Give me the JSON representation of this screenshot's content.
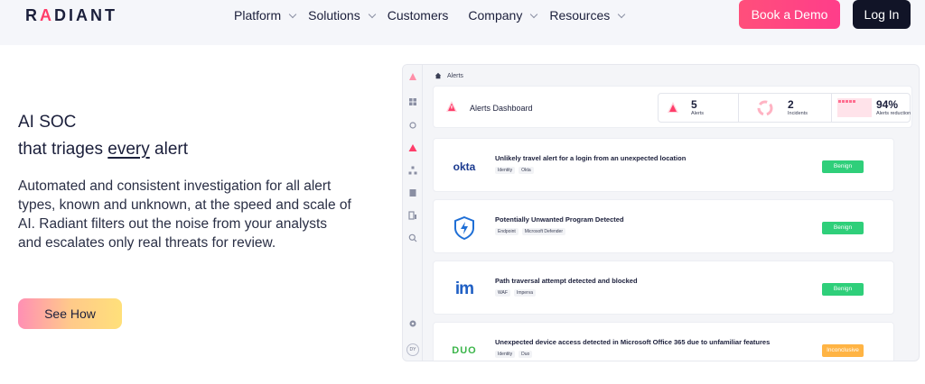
{
  "brand": {
    "logo_text_pre": "R",
    "logo_text_a": "A",
    "logo_text_post": "DIANT"
  },
  "nav": {
    "items": [
      {
        "label": "Platform",
        "has_dropdown": true
      },
      {
        "label": "Solutions",
        "has_dropdown": true
      },
      {
        "label": "Customers",
        "has_dropdown": false
      },
      {
        "label": "Company",
        "has_dropdown": true
      },
      {
        "label": "Resources",
        "has_dropdown": true
      }
    ],
    "book_demo": "Book a Demo",
    "login": "Log In"
  },
  "hero": {
    "title_line1": "AI SOC",
    "title_line2_pre": "that triages ",
    "title_line2_em": "every",
    "title_line2_post": " alert",
    "description": "Automated and consistent investigation for all alert types, known and unknown, at the speed and scale of AI. Radiant filters out the noise from your analysts and escalates only real threats for review.",
    "cta": "See How"
  },
  "dashboard": {
    "breadcrumb": "Alerts",
    "title": "Alerts Dashboard",
    "stats": [
      {
        "value": "5",
        "label": "Alerts"
      },
      {
        "value": "2",
        "label": "Incidents"
      },
      {
        "value": "94%",
        "label": "Alerts reduction"
      }
    ],
    "alerts": [
      {
        "vendor": "okta",
        "title": "Unlikely travel alert for a login from an unexpected location",
        "tags": [
          "Identity",
          "Okta"
        ],
        "status": "Benign",
        "status_type": "benign"
      },
      {
        "vendor": "microsoft-defender",
        "title": "Potentially Unwanted Program Detected",
        "tags": [
          "Endpoint",
          "Microsoft Defender"
        ],
        "status": "Benign",
        "status_type": "benign"
      },
      {
        "vendor": "imperva",
        "title": "Path traversal attempt detected and blocked",
        "tags": [
          "WAF",
          "Imperva"
        ],
        "status": "Benign",
        "status_type": "benign"
      },
      {
        "vendor": "duo",
        "title": "Unexpected device access detected in Microsoft Office 365 due to unfamiliar features",
        "tags": [
          "Identity",
          "Duo"
        ],
        "status": "Inconclusive",
        "status_type": "inconclusive"
      }
    ],
    "vendor_logos": {
      "okta": "okta",
      "imperva": "im",
      "duo": "DUO"
    },
    "user_initials": "DY"
  },
  "colors": {
    "accent": "#ff4f7b",
    "dark": "#111427",
    "benign": "#2fcf7a",
    "inconclusive": "#ffb444"
  }
}
